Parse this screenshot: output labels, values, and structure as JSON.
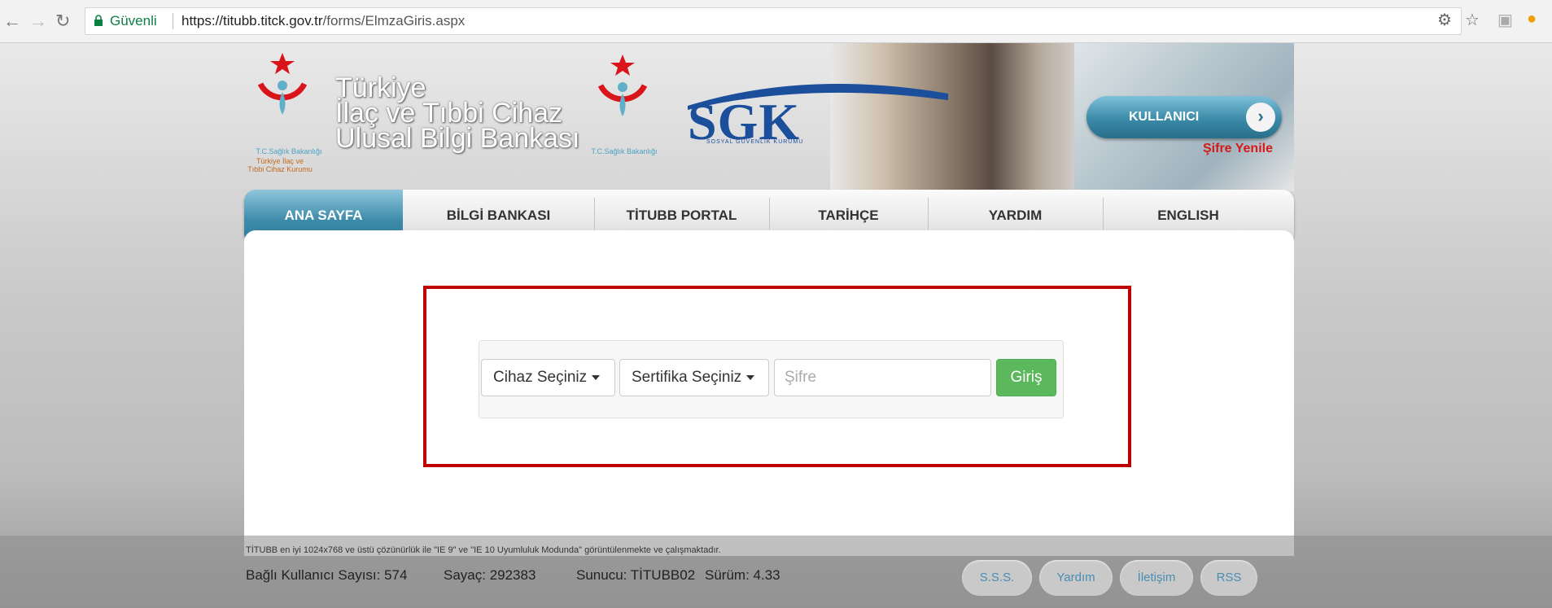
{
  "browser": {
    "secure_label": "Güvenli",
    "url_host": "https://titubb.titck.gov.tr",
    "url_path": "/forms/ElmzaGiris.aspx"
  },
  "header": {
    "title_lines": [
      "Türkiye",
      "İlaç ve Tıbbi Cihaz",
      "Ulusal Bilgi Bankası"
    ],
    "ministry_small": "T.C.Sağlık Bakanlığı",
    "agency_small": "Türkiye İlaç ve Tıbbi Cihaz Kurumu",
    "ministry_small_2": "T.C.Sağlık Bakanlığı",
    "sgk_logo": "SGK",
    "sgk_sub": "SOSYAL GÜVENLİK KURUMU",
    "user_button": "KULLANICI",
    "password_reset": "Şifre Yenile"
  },
  "menu": {
    "items": [
      "ANA SAYFA",
      "BİLGİ BANKASI",
      "TİTUBB PORTAL",
      "TARİHÇE",
      "YARDIM",
      "ENGLISH"
    ]
  },
  "form": {
    "device_select": "Cihaz Seçiniz",
    "cert_select": "Sertifika Seçiniz",
    "password_placeholder": "Şifre",
    "submit": "Giriş"
  },
  "footer": {
    "note": "TİTUBB en iyi 1024x768 ve üstü çözünürlük ile \"IE 9\" ve \"IE 10 Uyumluluk Modunda\" görüntülenmekte ve çalışmaktadır.",
    "connected_users": "Bağlı Kullanıcı Sayısı: 574",
    "counter": "Sayaç: 292383",
    "server": "Sunucu: TİTUBB02",
    "version": "Sürüm: 4.33",
    "links": [
      "S.S.S.",
      "Yardım",
      "İletişim",
      "RSS"
    ]
  },
  "colors": {
    "accent": "#3d8cab",
    "danger": "#d61a1a",
    "success": "#5cb85c",
    "highlight_box": "#c00000"
  }
}
